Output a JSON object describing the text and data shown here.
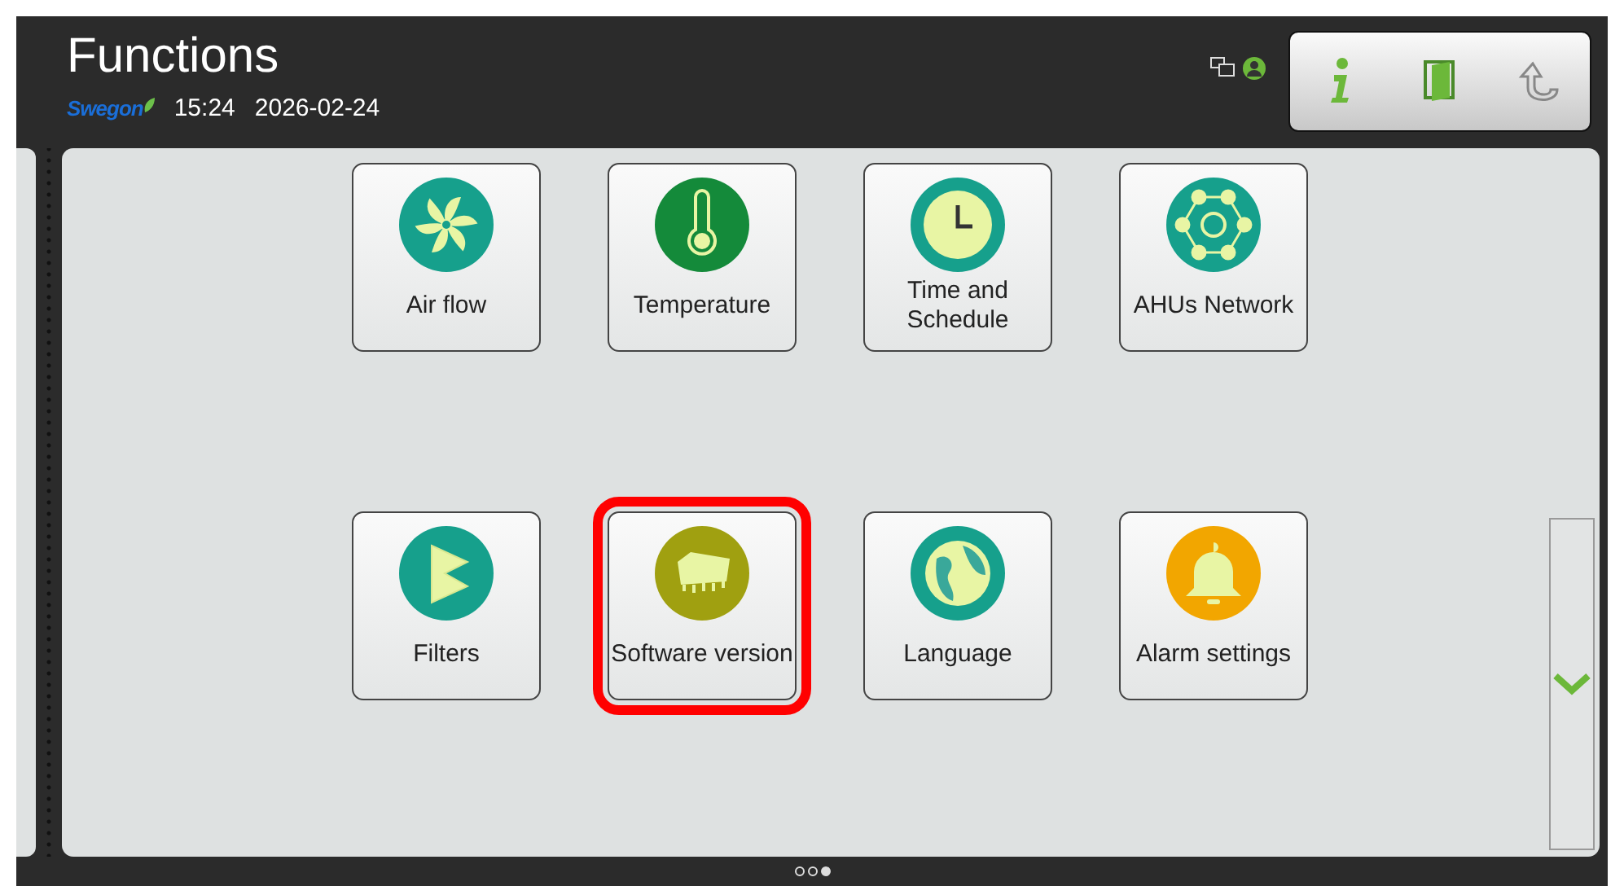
{
  "header": {
    "title": "Functions",
    "brand": "Swegon",
    "time": "15:24",
    "date": "2026-02-24"
  },
  "functions": [
    {
      "label": "Air flow",
      "kind": "fan",
      "color": "#16a08c",
      "highlighted": false
    },
    {
      "label": "Temperature",
      "kind": "thermometer",
      "color": "#148a3a",
      "highlighted": false
    },
    {
      "label": "Time and Schedule",
      "kind": "clock",
      "color": "#16a08c",
      "highlighted": false
    },
    {
      "label": "AHUs Network",
      "kind": "network",
      "color": "#16a08c",
      "highlighted": false
    },
    {
      "label": "Filters",
      "kind": "filter",
      "color": "#16a08c",
      "highlighted": false
    },
    {
      "label": "Software version",
      "kind": "chip",
      "color": "#a0a010",
      "highlighted": true
    },
    {
      "label": "Language",
      "kind": "globe",
      "color": "#16a08c",
      "highlighted": false
    },
    {
      "label": "Alarm settings",
      "kind": "bell",
      "color": "#f2a600",
      "highlighted": false
    }
  ],
  "pages": [
    {
      "selected": false
    },
    {
      "selected": false
    },
    {
      "selected": true
    }
  ]
}
